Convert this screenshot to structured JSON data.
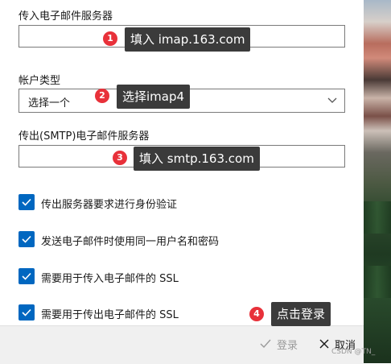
{
  "form": {
    "incoming_label": "传入电子邮件服务器",
    "incoming_value": "",
    "account_type_label": "帐户类型",
    "account_type_selected": "选择一个",
    "outgoing_label": "传出(SMTP)电子邮件服务器",
    "outgoing_value": ""
  },
  "checkboxes": [
    {
      "label": "传出服务器要求进行身份验证",
      "checked": true
    },
    {
      "label": "发送电子邮件时使用同一用户名和密码",
      "checked": true
    },
    {
      "label": "需要用于传入电子邮件的 SSL",
      "checked": true
    },
    {
      "label": "需要用于传出电子邮件的 SSL",
      "checked": true
    }
  ],
  "annotations": [
    {
      "number": "1",
      "text": "填入 imap.163.com"
    },
    {
      "number": "2",
      "text": "选择imap4"
    },
    {
      "number": "3",
      "text": "填入 smtp.163.com"
    },
    {
      "number": "4",
      "text": "点击登录"
    }
  ],
  "footer": {
    "login_label": "登录",
    "cancel_label": "取消"
  },
  "watermark": "CSDN @TN_",
  "colors": {
    "accent": "#0067c0",
    "callout_bg": "#3b3b3b",
    "badge": "#e8313a"
  }
}
